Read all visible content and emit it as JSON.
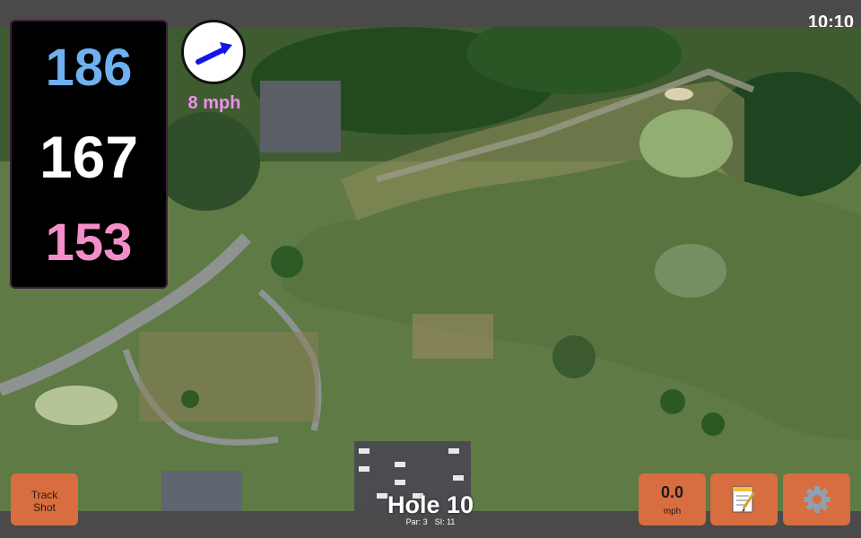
{
  "status": {
    "time": "10:10"
  },
  "distances": {
    "back": "186",
    "middle": "167",
    "front": "153"
  },
  "wind": {
    "speed": "8 mph",
    "icon": "wind-direction-arrow-icon"
  },
  "buttons": {
    "track_shot_line1": "Track",
    "track_shot_line2": "Shot",
    "speed_value": "0.0",
    "speed_unit": "mph",
    "notes_icon": "notepad-icon",
    "settings_icon": "gear-icon"
  },
  "hole": {
    "title": "Hole 10",
    "par": "Par: 3",
    "si": "SI: 11"
  },
  "colors": {
    "button": "#d86d3f",
    "back": "#6fb0f0",
    "middle": "#ffffff",
    "front": "#f48ec8",
    "wind_text": "#f08ff0"
  }
}
